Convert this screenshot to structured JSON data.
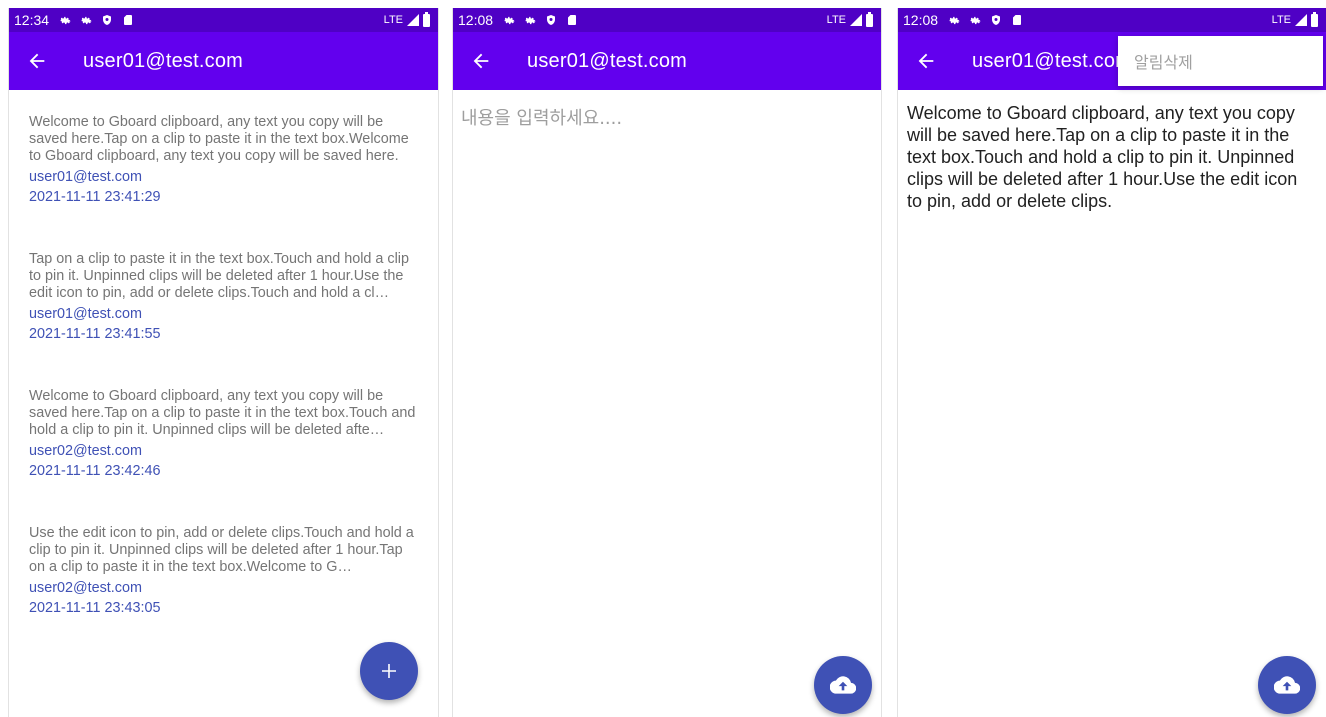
{
  "screen1": {
    "status_time": "12:34",
    "status_network": "LTE",
    "title": "user01@test.com",
    "clips": [
      {
        "text": "Welcome to Gboard clipboard, any text you copy will be saved here.Tap on a clip to paste it in the text box.Welcome to Gboard clipboard, any text you copy will be saved here.",
        "user": "user01@test.com",
        "date": "2021-11-11 23:41:29"
      },
      {
        "text": "Tap on a clip to paste it in the text box.Touch and hold a clip to pin it. Unpinned clips will be deleted after 1 hour.Use the edit icon to pin, add or delete clips.Touch and hold a cl…",
        "user": "user01@test.com",
        "date": "2021-11-11 23:41:55"
      },
      {
        "text": "Welcome to Gboard clipboard, any text you copy will be saved here.Tap on a clip to paste it in the text box.Touch and hold a clip to pin it. Unpinned clips will be deleted afte…",
        "user": "user02@test.com",
        "date": "2021-11-11 23:42:46"
      },
      {
        "text": "Use the edit icon to pin, add or delete clips.Touch and hold a clip to pin it. Unpinned clips will be deleted after 1 hour.Tap on a clip to paste it in the text box.Welcome to G…",
        "user": "user02@test.com",
        "date": "2021-11-11 23:43:05"
      }
    ],
    "fab_icon": "plus-icon"
  },
  "screen2": {
    "status_time": "12:08",
    "status_network": "LTE",
    "title": "user01@test.com",
    "editor_placeholder": "내용을 입력하세요....",
    "fab_icon": "cloud-upload-icon"
  },
  "screen3": {
    "status_time": "12:08",
    "status_network": "LTE",
    "title": "user01@test.com",
    "menu_item": "알림삭제",
    "content": "Welcome to Gboard clipboard, any text you copy will be saved here.Tap on a clip to paste it in the text box.Touch and hold a clip to pin it. Unpinned clips will be deleted after 1 hour.Use the edit icon to pin, add or delete clips.",
    "fab_icon": "cloud-upload-icon"
  },
  "colors": {
    "status_bar": "#4f00c5",
    "app_bar": "#6200ee",
    "accent": "#3f51b5",
    "clip_text": "#757575"
  }
}
